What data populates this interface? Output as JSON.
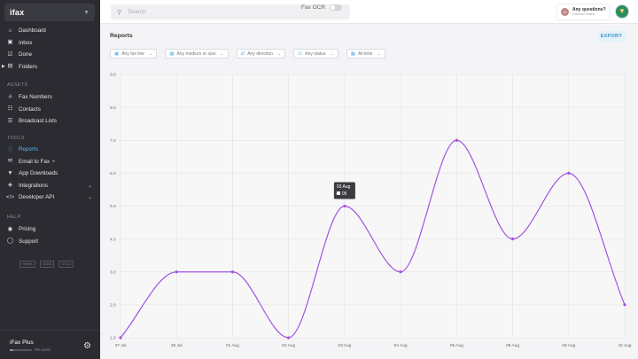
{
  "brand": {
    "name": "ifax"
  },
  "nav": {
    "top": [
      {
        "label": "Dashboard",
        "icon": "home-icon"
      },
      {
        "label": "Inbox",
        "icon": "inbox-icon"
      },
      {
        "label": "Done",
        "icon": "check-icon"
      },
      {
        "label": "Folders",
        "icon": "folder-icon"
      }
    ],
    "assets_title": "ASSETS",
    "assets": [
      {
        "label": "Fax Numbers",
        "icon": "hash-icon"
      },
      {
        "label": "Contacts",
        "icon": "contacts-icon"
      },
      {
        "label": "Broadcast Lists",
        "icon": "list-icon"
      }
    ],
    "tools_title": "TOOLS",
    "tools": [
      {
        "label": "Reports",
        "icon": "bar-chart-icon",
        "active": true
      },
      {
        "label": "Email to Fax",
        "icon": "email-icon"
      },
      {
        "label": "App Downloads",
        "icon": "download-icon"
      },
      {
        "label": "Integrations",
        "icon": "integrations-icon"
      },
      {
        "label": "Developer API",
        "icon": "code-icon"
      }
    ],
    "help_title": "HELP",
    "help": [
      {
        "label": "Pricing",
        "icon": "tag-icon"
      },
      {
        "label": "Support",
        "icon": "support-icon"
      }
    ]
  },
  "badges": [
    "HIPAA",
    "GLBA",
    "SOC2"
  ],
  "plan": {
    "name": "iFax Plus",
    "used": "0% used",
    "usage_fraction": 0.15
  },
  "topbar": {
    "search_placeholder": "Search",
    "ocr_label": "Fax OCR",
    "help_question": "Any questions?",
    "help_contact": "Contact Sales"
  },
  "page": {
    "title": "Reports",
    "export_label": "EXPORT",
    "filters": [
      "Any fax line",
      "Any medium or size",
      "Any direction",
      "Any status",
      "All time"
    ]
  },
  "tooltip": {
    "date": "03 Aug",
    "value": "05"
  },
  "colors": {
    "line": "#a352e0",
    "active_nav": "#5fb7e8",
    "sidebar": "#2b2b31"
  },
  "chart_data": {
    "type": "line",
    "title": "",
    "xlabel": "",
    "ylabel": "",
    "categories": [
      "27 Jul",
      "29 Jul",
      "01 Aug",
      "02 Aug",
      "03 Aug",
      "04 Aug",
      "06 Aug",
      "08 Aug",
      "09 Aug",
      "15 Aug"
    ],
    "values": [
      1,
      3,
      3,
      1,
      5,
      3,
      7,
      4,
      6,
      2
    ],
    "ylim": [
      1,
      9
    ],
    "yticks": [
      "1.0",
      "2.0",
      "3.0",
      "4.0",
      "5.0",
      "6.0",
      "7.0",
      "8.0",
      "9.0"
    ],
    "grid": true,
    "smooth": true
  }
}
